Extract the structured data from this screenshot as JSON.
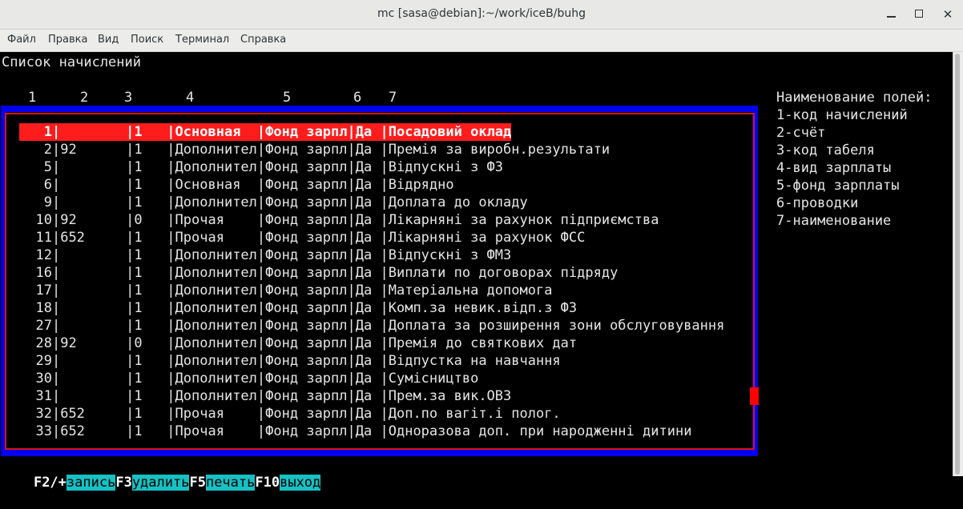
{
  "window": {
    "title": "mc [sasa@debian]:~/work/iceB/buhg",
    "min_icon": "minimize-icon",
    "max_icon": "maximize-icon",
    "close_icon": "close-icon"
  },
  "menu": [
    "Файл",
    "Правка",
    "Вид",
    "Поиск",
    "Терминал",
    "Справка"
  ],
  "screen": {
    "title": "Список начислений",
    "column_numbers": [
      "1",
      "2",
      "3",
      "4",
      "5",
      "6",
      "7"
    ]
  },
  "fields_legend": {
    "heading": "Наименование полей:",
    "items": [
      "1-код начислений",
      "2-счёт",
      "3-код табеля",
      "4-вид зарплаты",
      "5-фонд зарплаты",
      "6-проводки",
      "7-наименование"
    ]
  },
  "rows": [
    {
      "code": "1",
      "account": "",
      "tab": "1",
      "kind": "Основная",
      "fund": "Фонд зарпл",
      "post": "Да",
      "name": "Посадовий оклад",
      "selected": true
    },
    {
      "code": "2",
      "account": "92",
      "tab": "1",
      "kind": "Дополнител",
      "fund": "Фонд зарпл",
      "post": "Да",
      "name": "Премія за виробн.результати"
    },
    {
      "code": "5",
      "account": "",
      "tab": "1",
      "kind": "Дополнител",
      "fund": "Фонд зарпл",
      "post": "Да",
      "name": "Відпускні з ФЗ"
    },
    {
      "code": "6",
      "account": "",
      "tab": "1",
      "kind": "Основная",
      "fund": "Фонд зарпл",
      "post": "Да",
      "name": "Відрядно"
    },
    {
      "code": "9",
      "account": "",
      "tab": "1",
      "kind": "Дополнител",
      "fund": "Фонд зарпл",
      "post": "Да",
      "name": "Доплата до окладу"
    },
    {
      "code": "10",
      "account": "92",
      "tab": "0",
      "kind": "Прочая",
      "fund": "Фонд зарпл",
      "post": "Да",
      "name": "Лікарняні за рахунок підприємства"
    },
    {
      "code": "11",
      "account": "652",
      "tab": "1",
      "kind": "Прочая",
      "fund": "Фонд зарпл",
      "post": "Да",
      "name": "Лікарняні за рахунок ФСС"
    },
    {
      "code": "12",
      "account": "",
      "tab": "1",
      "kind": "Дополнител",
      "fund": "Фонд зарпл",
      "post": "Да",
      "name": "Відпускні з ФМЗ"
    },
    {
      "code": "16",
      "account": "",
      "tab": "1",
      "kind": "Дополнител",
      "fund": "Фонд зарпл",
      "post": "Да",
      "name": "Виплати по договорах підряду"
    },
    {
      "code": "17",
      "account": "",
      "tab": "1",
      "kind": "Дополнител",
      "fund": "Фонд зарпл",
      "post": "Да",
      "name": "Матеріальна допомога"
    },
    {
      "code": "18",
      "account": "",
      "tab": "1",
      "kind": "Дополнител",
      "fund": "Фонд зарпл",
      "post": "Да",
      "name": "Комп.за невик.відп.з ФЗ"
    },
    {
      "code": "27",
      "account": "",
      "tab": "1",
      "kind": "Дополнител",
      "fund": "Фонд зарпл",
      "post": "Да",
      "name": "Доплата за розширення зони обслуговування"
    },
    {
      "code": "28",
      "account": "92",
      "tab": "0",
      "kind": "Дополнител",
      "fund": "Фонд зарпл",
      "post": "Да",
      "name": "Премія до святкових дат"
    },
    {
      "code": "29",
      "account": "",
      "tab": "1",
      "kind": "Дополнител",
      "fund": "Фонд зарпл",
      "post": "Да",
      "name": "Відпустка на навчання"
    },
    {
      "code": "30",
      "account": "",
      "tab": "1",
      "kind": "Дополнител",
      "fund": "Фонд зарпл",
      "post": "Да",
      "name": "Сумісництво"
    },
    {
      "code": "31",
      "account": "",
      "tab": "1",
      "kind": "Дополнител",
      "fund": "Фонд зарпл",
      "post": "Да",
      "name": "Прем.за вик.ОВЗ"
    },
    {
      "code": "32",
      "account": "652",
      "tab": "1",
      "kind": "Прочая",
      "fund": "Фонд зарпл",
      "post": "Да",
      "name": "Доп.по вагіт.і полог."
    },
    {
      "code": "33",
      "account": "652",
      "tab": "1",
      "kind": "Прочая",
      "fund": "Фонд зарпл",
      "post": "Да",
      "name": "Одноразова доп. при народженні дитини"
    }
  ],
  "keys": [
    {
      "key": "F2/+",
      "label": "запись"
    },
    {
      "key": "F3",
      "label": "удалить"
    },
    {
      "key": "F5",
      "label": "печать"
    },
    {
      "key": "F10",
      "label": "выход"
    }
  ],
  "colors": {
    "frame_blue": "#0000ee",
    "frame_red": "#dd1111",
    "selection": "#ff1c1c",
    "key_label_bg": "#16c1c4"
  }
}
